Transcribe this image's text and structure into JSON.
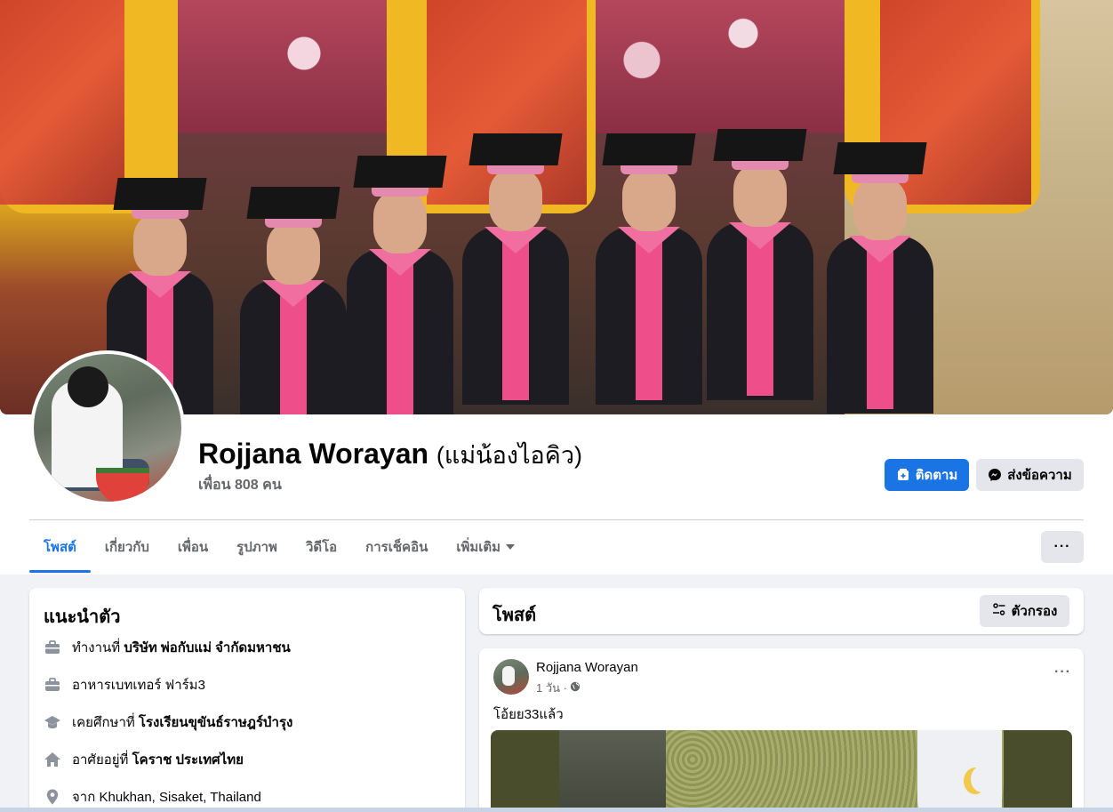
{
  "profile": {
    "name": "Rojjana Worayan",
    "nickname": "(แม่น้องไอคิว)",
    "friends_text": "เพื่อน 808 คน"
  },
  "actions": {
    "follow_label": "ติดตาม",
    "message_label": "ส่งข้อความ"
  },
  "tabs": [
    {
      "label": "โพสต์",
      "active": true
    },
    {
      "label": "เกี่ยวกับ",
      "active": false
    },
    {
      "label": "เพื่อน",
      "active": false
    },
    {
      "label": "รูปภาพ",
      "active": false
    },
    {
      "label": "วิดีโอ",
      "active": false
    },
    {
      "label": "การเช็คอิน",
      "active": false
    },
    {
      "label": "เพิ่มเติม",
      "active": false
    }
  ],
  "more_button_label": "···",
  "intro": {
    "title": "แนะนำตัว",
    "rows": [
      {
        "icon": "briefcase-icon",
        "prefix": "ทำงานที่ ",
        "bold": "บริษัท พ่อกับแม่ จำกัดมหาชน"
      },
      {
        "icon": "briefcase-icon",
        "prefix": "อาหารเบทเทอร์ ฟาร์ม3",
        "bold": ""
      },
      {
        "icon": "graduation-cap-icon",
        "prefix": "เคยศึกษาที่ ",
        "bold": "โรงเรียนขุขันธ์ราษฎร์บำรุง"
      },
      {
        "icon": "home-icon",
        "prefix": "อาศัยอยู่ที่ ",
        "bold": "โคราช ประเทศไทย"
      },
      {
        "icon": "location-pin-icon",
        "prefix": "จาก ",
        "bold": "Khukhan, Sisaket, Thailand"
      }
    ]
  },
  "posts_header": {
    "title": "โพสต์",
    "filter_label": "ตัวกรอง"
  },
  "post": {
    "author": "Rojjana Worayan",
    "time": "1 วัน ·",
    "text": "โอ้ยย33แล้ว",
    "more_label": "···"
  },
  "colors": {
    "accent": "#1b74e4",
    "secondary_text": "#65676b",
    "button_gray": "#e4e6eb",
    "page_bg": "#f0f2f5"
  }
}
